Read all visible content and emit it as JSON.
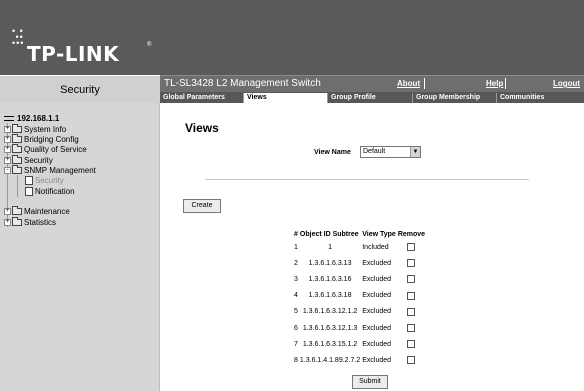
{
  "header": {
    "brand": "TP-LINK",
    "reg_mark": "®"
  },
  "left_title": "Security",
  "topbar": {
    "title": "TL-SL3428 L2 Management Switch",
    "links": {
      "about": "About",
      "help": "Help",
      "logout": "Logout"
    }
  },
  "tabs": [
    "Global Parameters",
    "Views",
    "Group Profile",
    "Group Membership",
    "Communities"
  ],
  "active_tab": "Views",
  "sidebar": {
    "host": "192.168.1.1",
    "items": [
      {
        "label": "System Info",
        "toggle": "+"
      },
      {
        "label": "Bridging Config",
        "toggle": "+"
      },
      {
        "label": "Quality of Service",
        "toggle": "+"
      },
      {
        "label": "Security",
        "toggle": "+"
      },
      {
        "label": "SNMP Management",
        "toggle": "-"
      },
      {
        "label": "Security"
      },
      {
        "label": "Notification"
      },
      {
        "label": "Maintenance",
        "toggle": "+"
      },
      {
        "label": "Statistics",
        "toggle": "+"
      }
    ]
  },
  "main": {
    "title": "Views",
    "view_name_label": "View Name",
    "view_name_value": "Default",
    "create_button": "Create",
    "submit_button": "Submit",
    "table": {
      "headers": [
        "#",
        "Object ID Subtree",
        "View Type",
        "Remove"
      ],
      "rows": [
        {
          "num": "1",
          "oid": "1",
          "type": "Included"
        },
        {
          "num": "2",
          "oid": "1.3.6.1.6.3.13",
          "type": "Excluded"
        },
        {
          "num": "3",
          "oid": "1.3.6.1.6.3.16",
          "type": "Excluded"
        },
        {
          "num": "4",
          "oid": "1.3.6.1.6.3.18",
          "type": "Excluded"
        },
        {
          "num": "5",
          "oid": "1.3.6.1.6.3.12.1.2",
          "type": "Excluded"
        },
        {
          "num": "6",
          "oid": "1.3.6.1.6.3.12.1.3",
          "type": "Excluded"
        },
        {
          "num": "7",
          "oid": "1.3.6.1.6.3.15.1.2",
          "type": "Excluded"
        },
        {
          "num": "8",
          "oid": "1.3.6.1.4.1.89.2.7.2",
          "type": "Excluded"
        }
      ]
    }
  }
}
